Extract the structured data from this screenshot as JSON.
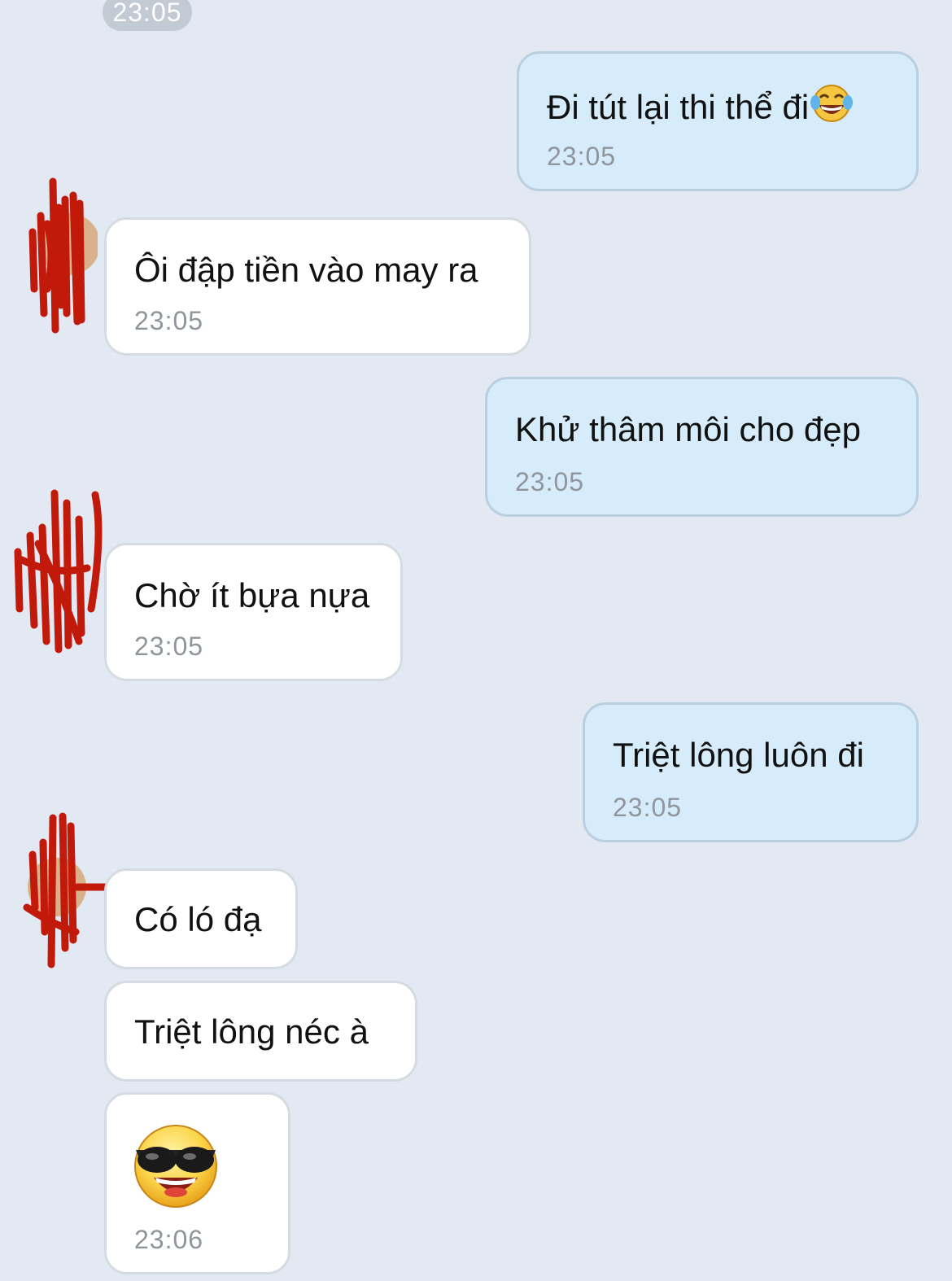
{
  "top_time": "23:05",
  "messages": [
    {
      "text": "Đi tút lại thi thể đi",
      "time": "23:05",
      "emoji": "tears-of-joy-emoji"
    },
    {
      "text": "Ôi đập tiền vào may ra",
      "time": "23:05"
    },
    {
      "text": "Khử thâm môi cho đẹp",
      "time": "23:05"
    },
    {
      "text": "Chờ ít bựa nựa",
      "time": "23:05"
    },
    {
      "text": "Triệt lông luôn đi",
      "time": "23:05"
    },
    {
      "text": "Có ló đạ"
    },
    {
      "text": "Triệt lông néc à"
    },
    {
      "emoji": "sunglasses-emoji",
      "time": "23:06"
    }
  ],
  "colors": {
    "background": "#e3e9f2",
    "sent_bubble": "#d6ecfb",
    "received_bubble": "#ffffff",
    "scribble": "#c21a0a"
  }
}
